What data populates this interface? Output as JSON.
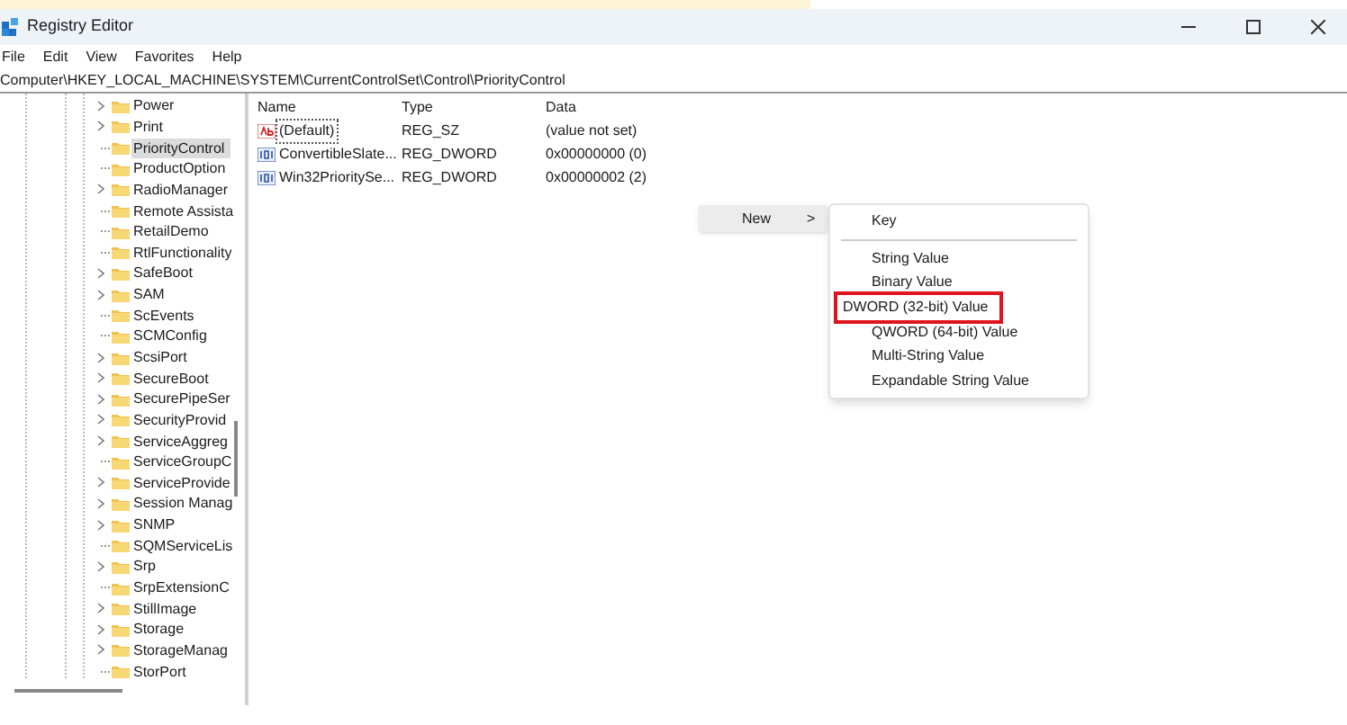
{
  "window": {
    "title": "Registry Editor"
  },
  "menu": [
    "File",
    "Edit",
    "View",
    "Favorites",
    "Help"
  ],
  "address": "Computer\\HKEY_LOCAL_MACHINE\\SYSTEM\\CurrentControlSet\\Control\\PriorityControl",
  "tree": {
    "items": [
      {
        "label": "Power",
        "expandable": true,
        "selected": false
      },
      {
        "label": "Print",
        "expandable": true,
        "selected": false
      },
      {
        "label": "PriorityControl",
        "expandable": false,
        "selected": true
      },
      {
        "label": "ProductOption",
        "expandable": false,
        "selected": false
      },
      {
        "label": "RadioManager",
        "expandable": true,
        "selected": false
      },
      {
        "label": "Remote Assista",
        "expandable": false,
        "selected": false
      },
      {
        "label": "RetailDemo",
        "expandable": false,
        "selected": false
      },
      {
        "label": "RtlFunctionality",
        "expandable": false,
        "selected": false
      },
      {
        "label": "SafeBoot",
        "expandable": true,
        "selected": false
      },
      {
        "label": "SAM",
        "expandable": true,
        "selected": false
      },
      {
        "label": "ScEvents",
        "expandable": false,
        "selected": false
      },
      {
        "label": "SCMConfig",
        "expandable": false,
        "selected": false
      },
      {
        "label": "ScsiPort",
        "expandable": true,
        "selected": false
      },
      {
        "label": "SecureBoot",
        "expandable": true,
        "selected": false
      },
      {
        "label": "SecurePipeSer",
        "expandable": true,
        "selected": false
      },
      {
        "label": "SecurityProvid",
        "expandable": true,
        "selected": false
      },
      {
        "label": "ServiceAggreg",
        "expandable": true,
        "selected": false
      },
      {
        "label": "ServiceGroupC",
        "expandable": false,
        "selected": false
      },
      {
        "label": "ServiceProvide",
        "expandable": true,
        "selected": false
      },
      {
        "label": "Session Manag",
        "expandable": true,
        "selected": false
      },
      {
        "label": "SNMP",
        "expandable": true,
        "selected": false
      },
      {
        "label": "SQMServiceLis",
        "expandable": false,
        "selected": false
      },
      {
        "label": "Srp",
        "expandable": true,
        "selected": false
      },
      {
        "label": "SrpExtensionC",
        "expandable": false,
        "selected": false
      },
      {
        "label": "StillImage",
        "expandable": true,
        "selected": false
      },
      {
        "label": "Storage",
        "expandable": true,
        "selected": false
      },
      {
        "label": "StorageManag",
        "expandable": true,
        "selected": false
      },
      {
        "label": "StorPort",
        "expandable": false,
        "selected": false
      }
    ]
  },
  "values": {
    "columns": [
      "Name",
      "Type",
      "Data"
    ],
    "rows": [
      {
        "kind": "string",
        "name": "(Default)",
        "type": "REG_SZ",
        "data": "(value not set)",
        "focused": true
      },
      {
        "kind": "binary",
        "name": "ConvertibleSlate...",
        "type": "REG_DWORD",
        "data": "0x00000000 (0)",
        "focused": false
      },
      {
        "kind": "binary",
        "name": "Win32PrioritySe...",
        "type": "REG_DWORD",
        "data": "0x00000002 (2)",
        "focused": false
      }
    ]
  },
  "context_menu": {
    "label": "New",
    "arrow": ">",
    "submenu": [
      {
        "kind": "item",
        "label": "Key",
        "highlighted": false
      },
      {
        "kind": "separator"
      },
      {
        "kind": "item",
        "label": "String Value",
        "highlighted": false
      },
      {
        "kind": "item",
        "label": "Binary Value",
        "highlighted": false
      },
      {
        "kind": "item",
        "label": "DWORD (32-bit) Value",
        "highlighted": true
      },
      {
        "kind": "item",
        "label": "QWORD (64-bit) Value",
        "highlighted": false
      },
      {
        "kind": "item",
        "label": "Multi-String Value",
        "highlighted": false
      },
      {
        "kind": "item",
        "label": "Expandable String Value",
        "highlighted": false
      }
    ]
  }
}
